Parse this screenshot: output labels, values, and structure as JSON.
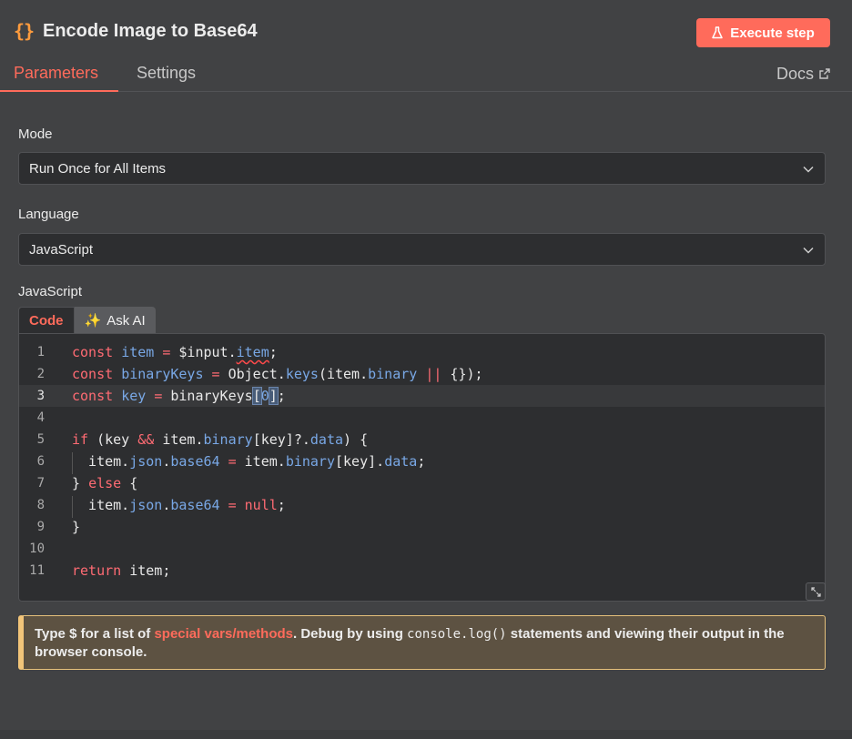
{
  "header": {
    "title": "Encode Image to Base64",
    "title_icon": "curly-braces-icon",
    "execute_label": "Execute step",
    "docs_label": "Docs"
  },
  "tabs": [
    {
      "label": "Parameters",
      "active": true
    },
    {
      "label": "Settings",
      "active": false
    }
  ],
  "mode": {
    "label": "Mode",
    "value": "Run Once for All Items"
  },
  "language": {
    "label": "Language",
    "value": "JavaScript"
  },
  "code": {
    "label": "JavaScript",
    "tab_code": "Code",
    "tab_ask": "Ask AI",
    "ask_icon": "✨",
    "active_line": 3,
    "line_numbers": [
      "1",
      "2",
      "3",
      "4",
      "5",
      "6",
      "7",
      "8",
      "9",
      "10",
      "11"
    ],
    "lines": [
      "const item = $input.item;",
      "const binaryKeys = Object.keys(item.binary || {});",
      "const key = binaryKeys[0];",
      "",
      "if (key && item.binary[key]?.data) {",
      "  item.json.base64 = item.binary[key].data;",
      "} else {",
      "  item.json.base64 = null;",
      "}",
      "",
      "return item;"
    ]
  },
  "notice": {
    "prefix": "Type ",
    "dollar": "$",
    "mid": " for a list of ",
    "link": "special vars/methods",
    "after_link": ". Debug by using ",
    "code": "console.log()",
    "suffix": " statements and viewing their output in the browser console."
  },
  "colors": {
    "accent": "#ff6b5b",
    "keyword": "#ff6b73",
    "variable": "#79a8e6",
    "warning_border": "#f2c579"
  }
}
